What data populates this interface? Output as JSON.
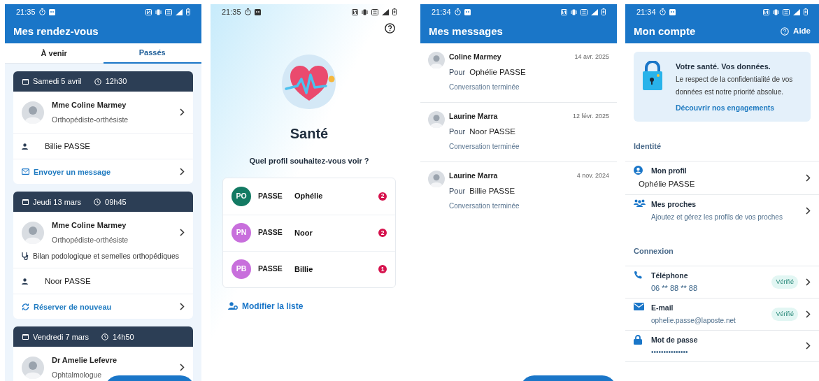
{
  "appointments_screen": {
    "status_bar": {
      "time": "21:35"
    },
    "title": "Mes rendez-vous",
    "tabs": [
      {
        "label": "À venir",
        "selected": false
      },
      {
        "label": "Passés",
        "selected": true
      }
    ],
    "appointments": [
      {
        "date": "Samedi 5 avril",
        "time": "12h30",
        "doctor": "Mme Coline Marmey",
        "specialty": "Orthopédiste-orthésiste",
        "patient": "Billie PASSE",
        "action": {
          "kind": "message",
          "label": "Envoyer un message"
        }
      },
      {
        "date": "Jeudi 13 mars",
        "time": "09h45",
        "doctor": "Mme Coline Marmey",
        "specialty": "Orthopédiste-orthésiste",
        "reason": "Bilan podologique et semelles orthopédiques",
        "patient": "Noor PASSE",
        "action": {
          "kind": "rebook",
          "label": "Réserver de nouveau"
        }
      },
      {
        "date": "Vendredi 7 mars",
        "time": "14h50",
        "doctor": "Dr Amelie Lefevre",
        "specialty": "Ophtalmologue"
      }
    ]
  },
  "profiles_screen": {
    "status_bar": {
      "time": "21:35"
    },
    "title": "Santé",
    "question": "Quel profil souhaitez-vous voir ?",
    "profiles": [
      {
        "initials": "PO",
        "color": "#137a63",
        "last_name": "PASSE",
        "first_name": "Ophélie",
        "count": "2"
      },
      {
        "initials": "PN",
        "color": "#c86fdc",
        "last_name": "PASSE",
        "first_name": "Noor",
        "count": "2"
      },
      {
        "initials": "PB",
        "color": "#c86fdc",
        "last_name": "PASSE",
        "first_name": "Billie",
        "count": "1"
      }
    ],
    "edit_link": "Modifier la liste"
  },
  "messages_screen": {
    "status_bar": {
      "time": "21:34"
    },
    "title": "Mes messages",
    "messages": [
      {
        "sender": "Coline Marmey",
        "date": "14 avr. 2025",
        "for_label": "Pour",
        "recipient": "Ophélie PASSE",
        "status": "Conversation terminée"
      },
      {
        "sender": "Laurine Marra",
        "date": "12 févr. 2025",
        "for_label": "Pour",
        "recipient": "Noor PASSE",
        "status": "Conversation terminée"
      },
      {
        "sender": "Laurine Marra",
        "date": "4 nov. 2024",
        "for_label": "Pour",
        "recipient": "Billie PASSE",
        "status": "Conversation terminée"
      }
    ]
  },
  "account_screen": {
    "status_bar": {
      "time": "21:34"
    },
    "title": "Mon compte",
    "help": "Aide",
    "privacy_card": {
      "title": "Votre santé. Vos données.",
      "text": "Le respect de la confidentialité de vos données est notre priorité absolue.",
      "link": "Découvrir nos engagements"
    },
    "sections": [
      {
        "title": "Identité",
        "rows": [
          {
            "kind": "profile",
            "label": "Mon profil",
            "value": "Ophélie PASSE"
          },
          {
            "kind": "relatives",
            "label": "Mes proches",
            "value": "Ajoutez et gérez les profils de vos proches"
          }
        ]
      },
      {
        "title": "Connexion",
        "rows": [
          {
            "kind": "phone",
            "label": "Téléphone",
            "value": "06  ** 88 ** 88",
            "badge": "Vérifié"
          },
          {
            "kind": "email",
            "label": "E-mail",
            "value": "ophelie.passe@laposte.net",
            "badge": "Vérifié"
          },
          {
            "kind": "password",
            "label": "Mot de passe",
            "value": "•••••••••••••••"
          }
        ]
      }
    ]
  }
}
